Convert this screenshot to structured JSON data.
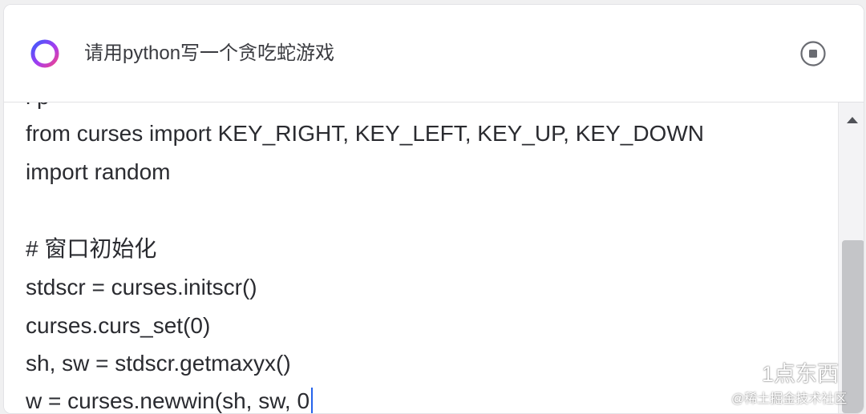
{
  "header": {
    "prompt": "请用python写一个贪吃蛇游戏",
    "logo_icon": "assistant-ring-logo-icon",
    "stop_icon": "stop-circle-icon"
  },
  "code": {
    "lines": [
      "from curses import KEY_RIGHT, KEY_LEFT, KEY_UP, KEY_DOWN",
      "import random",
      "",
      "# 窗口初始化",
      "stdscr = curses.initscr()",
      "curses.curs_set(0)",
      "sh, sw = stdscr.getmaxyx()",
      "w = curses.newwin(sh, sw, 0"
    ]
  },
  "scrollbar": {
    "up_icon": "scroll-up-arrow-icon"
  },
  "watermark": {
    "label": "1点东西",
    "sub": "@稀土掘金技术社区",
    "icon": "wechat-icon"
  },
  "colors": {
    "accent": "#2563eb",
    "logo_gradient": [
      "#3b5bfd",
      "#a43cf0",
      "#f0448c"
    ]
  }
}
